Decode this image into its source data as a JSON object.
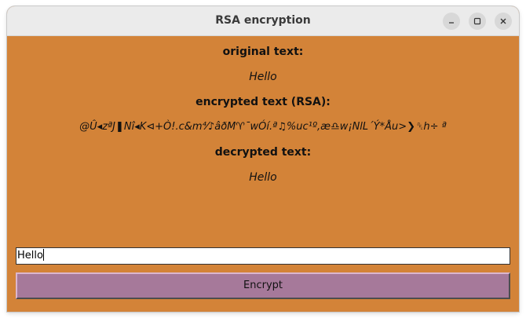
{
  "window": {
    "title": "RSA encryption",
    "controls": {
      "minimize_icon": "minimize-icon",
      "maximize_icon": "maximize-icon",
      "close_icon": "close-icon"
    }
  },
  "labels": {
    "original_heading": "original text:",
    "original_value": "Hello",
    "encrypted_heading": "encrypted text (RSA):",
    "encrypted_value": "@Û◂zªJ❚Nî◂K⊲+Ò!.c&m⁴⁄♪âðM♈¯wÓí.ª♫%uc¹º,æ♎w¡NlL´Ý*Åu>❯␡h÷ ª",
    "decrypted_heading": "decrypted text:",
    "decrypted_value": "Hello"
  },
  "input": {
    "value": "Hello"
  },
  "buttons": {
    "encrypt_label": "Encrypt"
  },
  "colors": {
    "background": "#d38338",
    "button": "#a6799a",
    "titlebar": "#ebebeb"
  }
}
